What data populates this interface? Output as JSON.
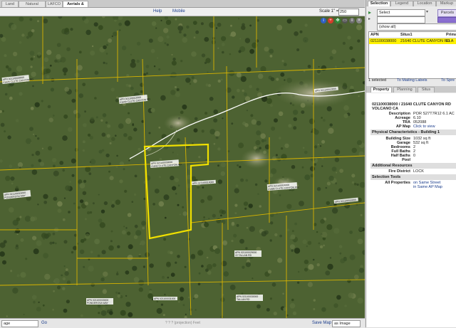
{
  "top_tabs": [
    "Land Use",
    "Natural Features",
    "LAFCO",
    "Aerials & Topo"
  ],
  "toolbar": {
    "help": "Help",
    "mobile": "Mobile",
    "scale_label": "Scale 1\" =",
    "scale_value": "250"
  },
  "bottom_bar": {
    "left_select": "age",
    "go": "Go",
    "coords": "? ? ? (projection)   Feet",
    "save_map": "Save Map",
    "format": "as Image"
  },
  "map": {
    "colors": {
      "parcel_line": "#d8b400",
      "selected_parcel": "#f0e000",
      "road": "#ffffff",
      "imagery": "#4d6232"
    },
    "labels": [
      "APN 021100028000",
      "21626 CLUTE CANYON RD",
      "APN 021100012000",
      "21640 CLUTE CANYON RD",
      "APN 021100013000",
      "APN 021100038000",
      "21640 CLUTE CANYON RD",
      "APN 021100004000",
      "21686 CLUTE CANYON RD",
      "APN 021100014000",
      "APN 021100015000",
      "PONDEROSA WAY",
      "APN 021100016000",
      "APN 021100029000",
      "22 TALLAN RD",
      "APN 021100030000",
      "TALLAN RD",
      "APN 021100031000",
      "APN 021100033000",
      "PONDEROSA WAY"
    ]
  },
  "right_tabs_1": [
    "Selection",
    "Legend",
    "Location",
    "Markup"
  ],
  "right_tabs_2": [
    "Property",
    "Planning",
    "Situs"
  ],
  "selection": {
    "select_label": "Select",
    "parcels_button": "Parcels",
    "show_all": "(show all)",
    "columns": [
      "APN",
      "Situs1",
      "Prima"
    ],
    "row": [
      "021100038000",
      "21640 CLUTE CANYON RD",
      "ELA"
    ],
    "count": "1 selected",
    "mailing": "To Mailing Labels",
    "spread": "To Spre"
  },
  "property": {
    "title1": "021100038000 / 21640 CLUTE CANYON RD",
    "title2": "VOLCANO CA",
    "fields": [
      {
        "label": "Description",
        "value": "POR S27T7R12 6.1 AC"
      },
      {
        "label": "Acreage",
        "value": "6.10"
      },
      {
        "label": "TRA",
        "value": "052088"
      },
      {
        "label": "AP Map",
        "value": "Click to view"
      }
    ],
    "physical_title": "Physical Characteristics - Building 1",
    "physical": [
      {
        "label": "Building Size",
        "value": "1032 sq ft"
      },
      {
        "label": "Garage",
        "value": "532 sq ft"
      },
      {
        "label": "Bedrooms",
        "value": "2"
      },
      {
        "label": "Full Baths",
        "value": "2"
      },
      {
        "label": "Half Baths",
        "value": "0"
      },
      {
        "label": "Pool",
        "value": ""
      }
    ],
    "additional_title": "Additional Resources",
    "fire_label": "Fire District",
    "fire_value": "LOCK",
    "selection_tools_title": "Selection Tools",
    "all_props_label": "All Properties",
    "all_props_1": "on Same Street",
    "all_props_2": "in Same AP Map"
  }
}
